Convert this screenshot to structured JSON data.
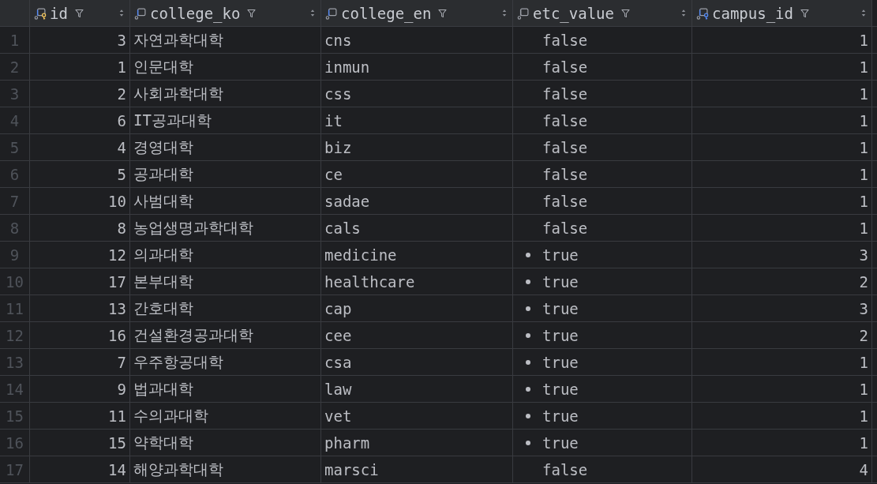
{
  "columns": [
    {
      "name": "id",
      "kind": "primary_key"
    },
    {
      "name": "college_ko",
      "kind": "indexed"
    },
    {
      "name": "college_en",
      "kind": "indexed"
    },
    {
      "name": "etc_value",
      "kind": "plain"
    },
    {
      "name": "campus_id",
      "kind": "foreign_key"
    }
  ],
  "rows": [
    {
      "number": "1",
      "id": "3",
      "college_ko": "자연과학대학",
      "college_en": "cns",
      "etc_value": "false",
      "dot": false,
      "campus_id": "1"
    },
    {
      "number": "2",
      "id": "1",
      "college_ko": "인문대학",
      "college_en": "inmun",
      "etc_value": "false",
      "dot": false,
      "campus_id": "1"
    },
    {
      "number": "3",
      "id": "2",
      "college_ko": "사회과학대학",
      "college_en": "css",
      "etc_value": "false",
      "dot": false,
      "campus_id": "1"
    },
    {
      "number": "4",
      "id": "6",
      "college_ko": "IT공과대학",
      "college_en": "it",
      "etc_value": "false",
      "dot": false,
      "campus_id": "1"
    },
    {
      "number": "5",
      "id": "4",
      "college_ko": "경영대학",
      "college_en": "biz",
      "etc_value": "false",
      "dot": false,
      "campus_id": "1"
    },
    {
      "number": "6",
      "id": "5",
      "college_ko": "공과대학",
      "college_en": "ce",
      "etc_value": "false",
      "dot": false,
      "campus_id": "1"
    },
    {
      "number": "7",
      "id": "10",
      "college_ko": "사범대학",
      "college_en": "sadae",
      "etc_value": "false",
      "dot": false,
      "campus_id": "1"
    },
    {
      "number": "8",
      "id": "8",
      "college_ko": "농업생명과학대학",
      "college_en": "cals",
      "etc_value": "false",
      "dot": false,
      "campus_id": "1"
    },
    {
      "number": "9",
      "id": "12",
      "college_ko": "의과대학",
      "college_en": "medicine",
      "etc_value": "true",
      "dot": true,
      "campus_id": "3"
    },
    {
      "number": "10",
      "id": "17",
      "college_ko": "본부대학",
      "college_en": "healthcare",
      "etc_value": "true",
      "dot": true,
      "campus_id": "2"
    },
    {
      "number": "11",
      "id": "13",
      "college_ko": "간호대학",
      "college_en": "cap",
      "etc_value": "true",
      "dot": true,
      "campus_id": "3"
    },
    {
      "number": "12",
      "id": "16",
      "college_ko": "건설환경공과대학",
      "college_en": "cee",
      "etc_value": "true",
      "dot": true,
      "campus_id": "2"
    },
    {
      "number": "13",
      "id": "7",
      "college_ko": "우주항공대학",
      "college_en": "csa",
      "etc_value": "true",
      "dot": true,
      "campus_id": "1"
    },
    {
      "number": "14",
      "id": "9",
      "college_ko": "법과대학",
      "college_en": "law",
      "etc_value": "true",
      "dot": true,
      "campus_id": "1"
    },
    {
      "number": "15",
      "id": "11",
      "college_ko": "수의과대학",
      "college_en": "vet",
      "etc_value": "true",
      "dot": true,
      "campus_id": "1"
    },
    {
      "number": "16",
      "id": "15",
      "college_ko": "약학대학",
      "college_en": "pharm",
      "etc_value": "true",
      "dot": true,
      "campus_id": "1"
    },
    {
      "number": "17",
      "id": "14",
      "college_ko": "해양과학대학",
      "college_en": "marsci",
      "etc_value": "false",
      "dot": false,
      "campus_id": "4"
    }
  ]
}
